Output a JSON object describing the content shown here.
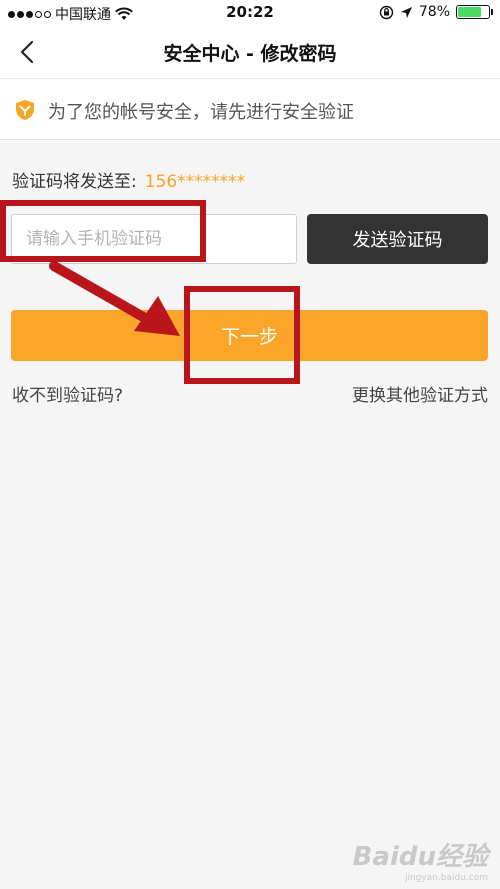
{
  "status_bar": {
    "carrier": "中国联通",
    "time": "20:22",
    "battery_percent": "78%",
    "battery_level": 0.78,
    "battery_color": "#4cd964"
  },
  "nav": {
    "title": "安全中心 - 修改密码",
    "back_icon": "chevron-left-icon"
  },
  "notice": {
    "icon": "shield-icon",
    "icon_color": "#f5a623",
    "text": "为了您的帐号安全，请先进行安全验证"
  },
  "verify": {
    "send_to_label": "验证码将发送至:",
    "phone_masked": "156********",
    "code_input_placeholder": "请输入手机验证码",
    "code_input_value": "",
    "send_code_label": "发送验证码",
    "next_label": "下一步",
    "no_code_link": "收不到验证码?",
    "other_method_link": "更换其他验证方式"
  },
  "colors": {
    "accent": "#fba62b",
    "dark_button": "#333333",
    "annotation": "#b8161b"
  },
  "watermark": {
    "logo": "Baidu经验",
    "site": "jingyan.baidu.com"
  }
}
